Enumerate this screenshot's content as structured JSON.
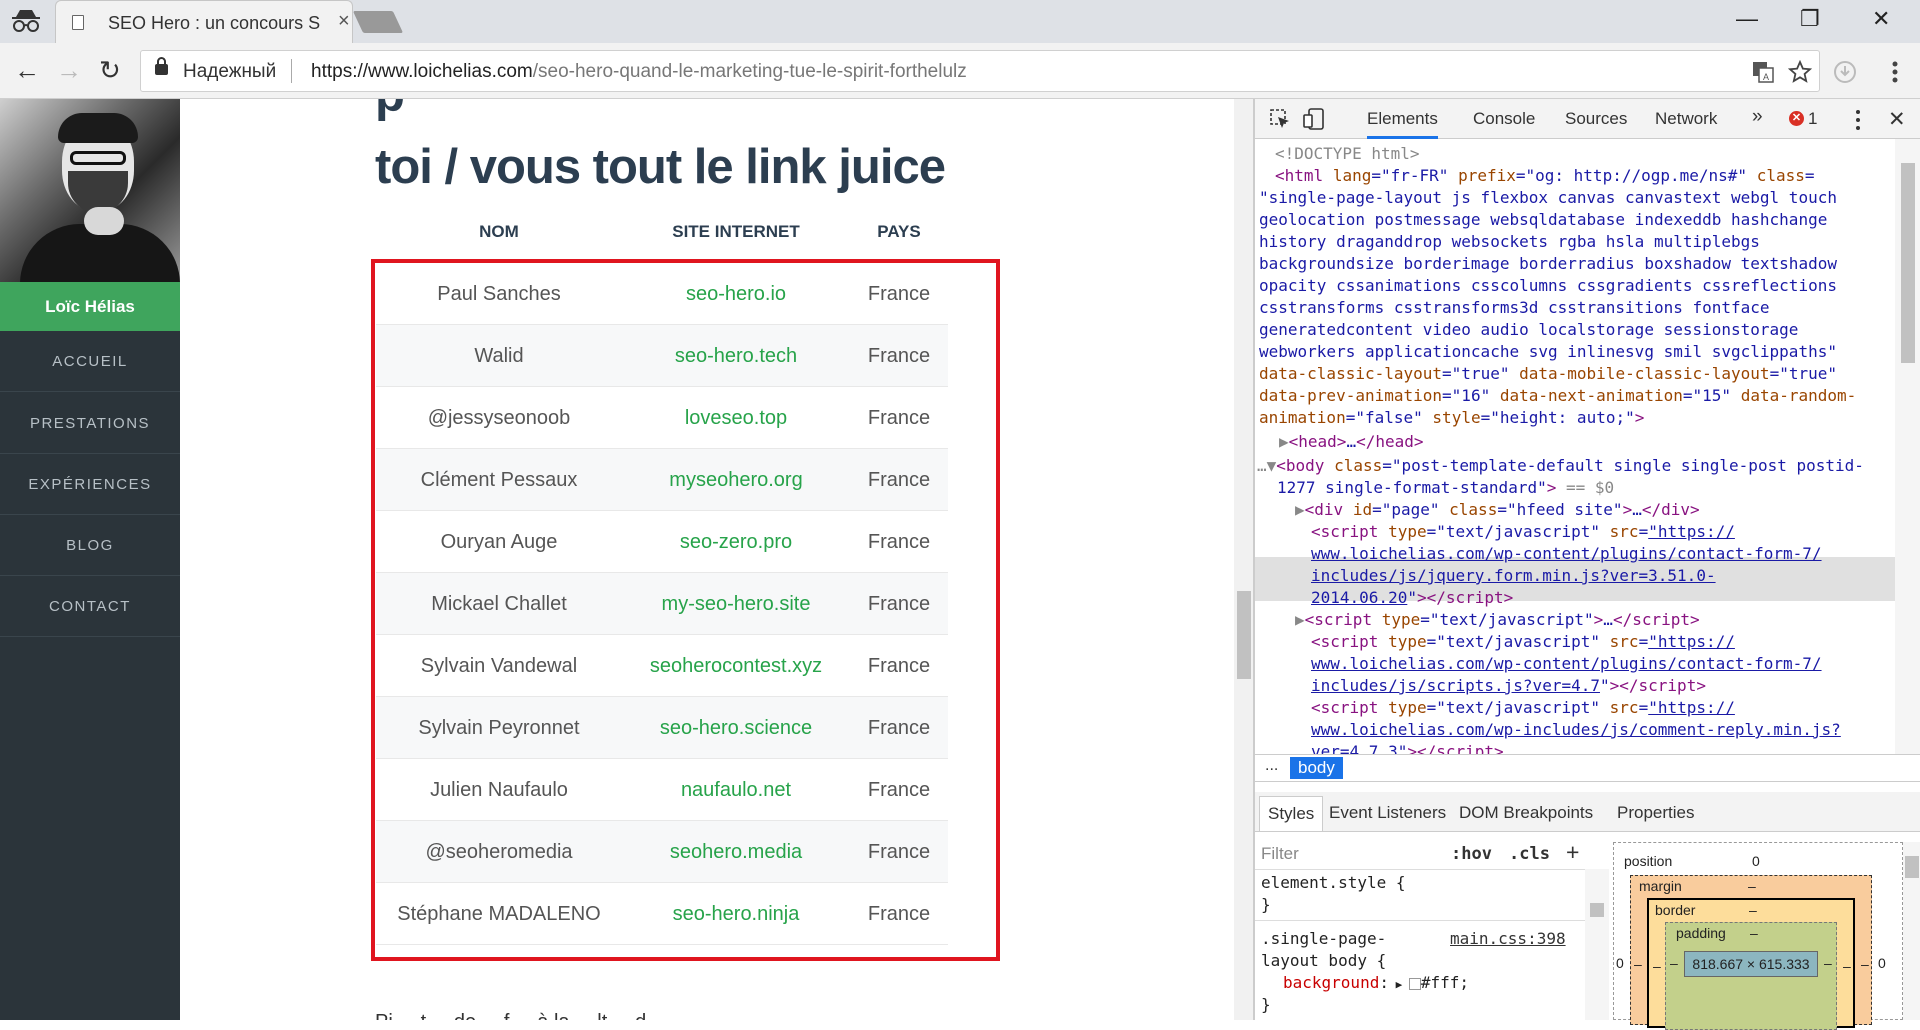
{
  "browser": {
    "tab_title": "SEO Hero : un concours S",
    "tab_close": "×",
    "window_controls": {
      "minimize": "—",
      "restore": "❐",
      "close": "✕"
    },
    "secure_label": "Надежный",
    "url_host": "https://www.loichelias.com",
    "url_path": "/seo-hero-quand-le-marketing-tue-le-spirit-forthelulz",
    "nav": {
      "back": "←",
      "forward": "→",
      "reload": "↻"
    },
    "icons": [
      "translate-icon",
      "star-icon",
      "extension-icon",
      "menu-icon"
    ]
  },
  "sidebar": {
    "name": "Loïc Hélias",
    "items": [
      {
        "label": "ACCUEIL"
      },
      {
        "label": "PRESTATIONS"
      },
      {
        "label": "EXPÉRIENCES"
      },
      {
        "label": "BLOG"
      },
      {
        "label": "CONTACT"
      }
    ]
  },
  "article": {
    "heading_fragment": "p",
    "heading_line": "toi / vous tout le link juice",
    "table": {
      "headers": [
        "NOM",
        "SITE INTERNET",
        "PAYS"
      ],
      "rows": [
        {
          "nom": "Paul Sanches",
          "site": "seo-hero.io",
          "pays": "France"
        },
        {
          "nom": "Walid",
          "site": "seo-hero.tech",
          "pays": "France"
        },
        {
          "nom": "@jessyseonoob",
          "site": "loveseo.top",
          "pays": "France"
        },
        {
          "nom": "Clément Pessaux",
          "site": "myseohero.org",
          "pays": "France"
        },
        {
          "nom": "Ouryan Auge",
          "site": "seo-zero.pro",
          "pays": "France"
        },
        {
          "nom": "Mickael Challet",
          "site": "my-seo-hero.site",
          "pays": "France"
        },
        {
          "nom": "Sylvain Vandewal",
          "site": "seoherocontest.xyz",
          "pays": "France"
        },
        {
          "nom": "Sylvain Peyronnet",
          "site": "seo-hero.science",
          "pays": "France"
        },
        {
          "nom": "Julien Naufaulo",
          "site": "naufaulo.net",
          "pays": "France"
        },
        {
          "nom": "@seoheromedia",
          "site": "seohero.media",
          "pays": "France"
        },
        {
          "nom": "Stéphane MADALENO",
          "site": "seo-hero.ninja",
          "pays": "France"
        }
      ]
    },
    "bottom_text": "Pi ... t ... de ... f ... à la ... lt ... d"
  },
  "devtools": {
    "tabs": [
      "Elements",
      "Console",
      "Sources",
      "Network"
    ],
    "more": "»",
    "error_count": "1",
    "breadcrumb_dots": "...",
    "breadcrumb_body": "body",
    "sub_tabs": [
      "Styles",
      "Event Listeners",
      "DOM Breakpoints",
      "Properties"
    ],
    "filter_placeholder": "Filter",
    "hov": ":hov",
    "cls": ".cls",
    "plus": "+",
    "styles": {
      "element_style": "element.style {",
      "close": "}",
      "rule_selector_1": ".single-page-",
      "rule_selector_2": "layout body {",
      "rule_source": "main.css:398",
      "prop": "background",
      "value": "#fff;"
    },
    "box_model": {
      "position_label": "position",
      "position_value": "0",
      "margin_label": "margin",
      "margin_value": "–",
      "border_label": "border",
      "border_value": "–",
      "padding_label": "padding",
      "padding_value": "–",
      "content": "818.667 × 615.333",
      "side_zero": "0",
      "side_dash": "–"
    }
  },
  "colors": {
    "accent": "#3fa55d",
    "link": "#27a34a",
    "highlight": "#e0151f",
    "devtools_blue": "#1a73e8"
  }
}
